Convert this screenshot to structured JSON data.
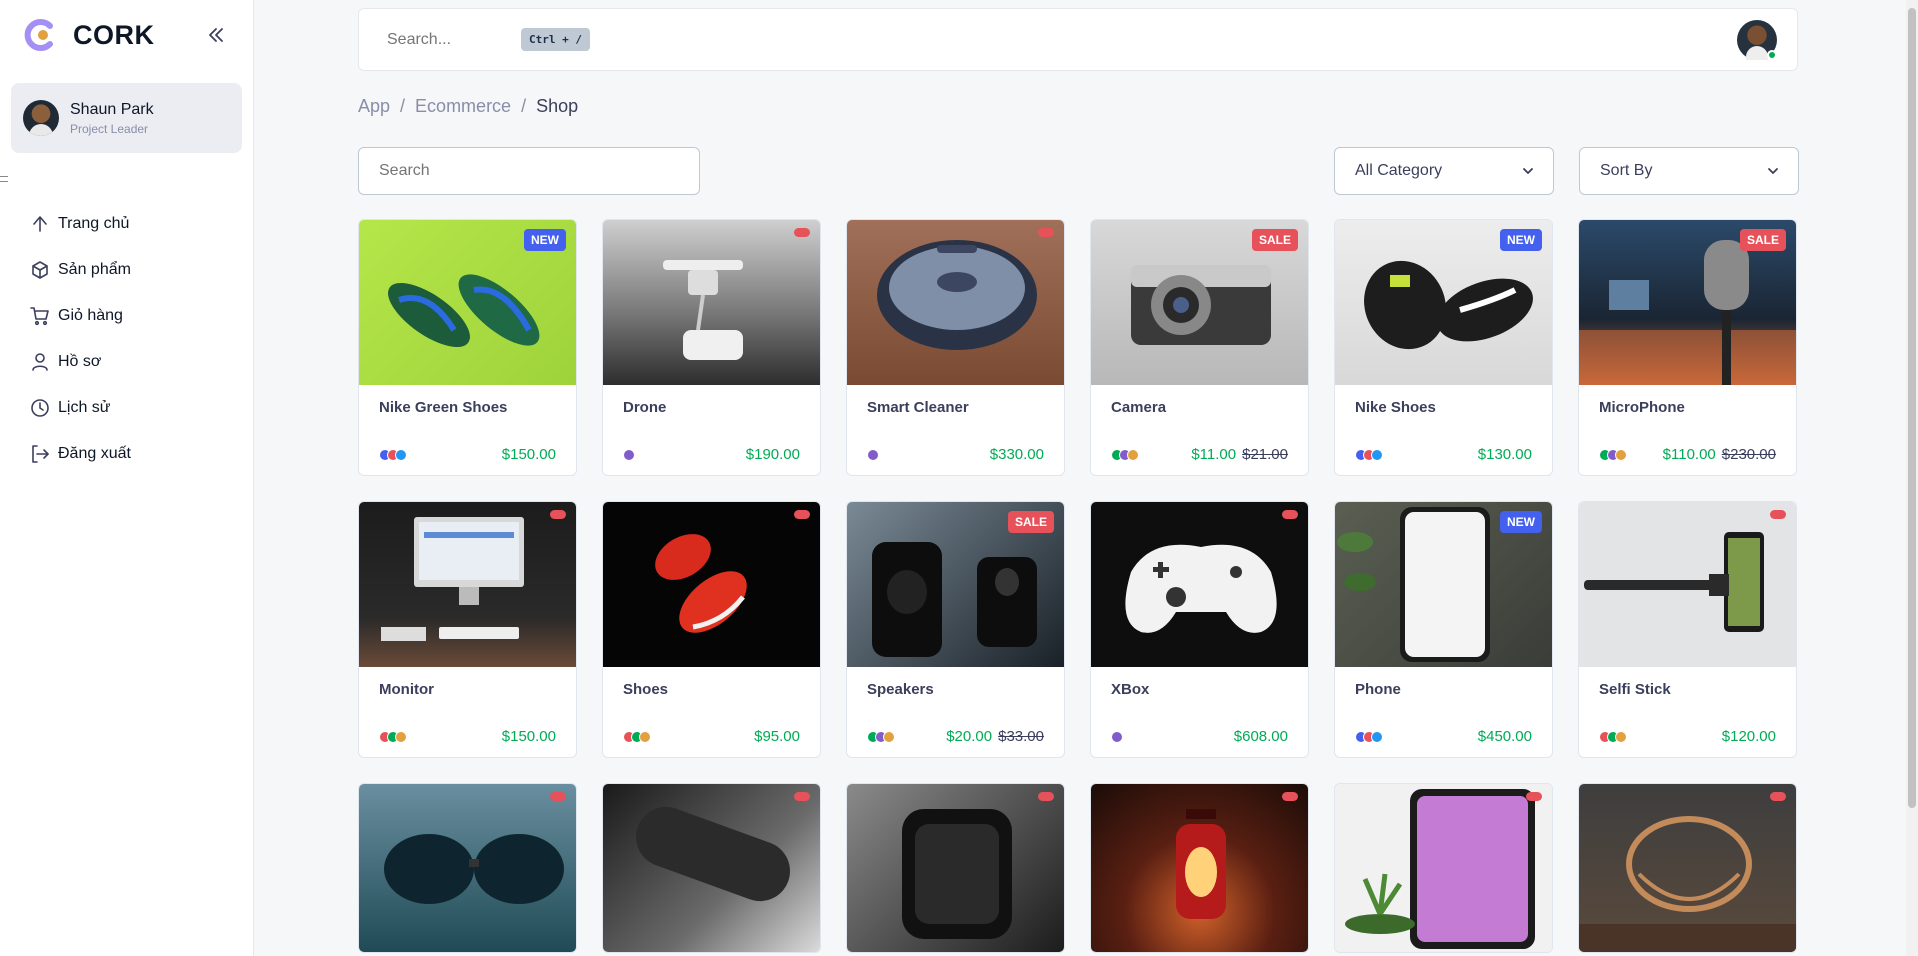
{
  "brand": {
    "name": "CORK"
  },
  "profile": {
    "name": "Shaun Park",
    "role": "Project Leader"
  },
  "menu": [
    {
      "label": "Trang chủ",
      "icon": "home-icon"
    },
    {
      "label": "Sản phẩm",
      "icon": "box-icon"
    },
    {
      "label": "Giỏ hàng",
      "icon": "cart-icon"
    },
    {
      "label": "Hồ sơ",
      "icon": "user-icon"
    },
    {
      "label": "Lịch sử",
      "icon": "clock-icon"
    },
    {
      "label": "Đăng xuất",
      "icon": "logout-icon"
    }
  ],
  "header": {
    "search_placeholder": "Search...",
    "shortcut": "Ctrl + /"
  },
  "breadcrumb": [
    "App",
    "Ecommerce",
    "Shop"
  ],
  "filters": {
    "search_placeholder": "Search",
    "category": "All Category",
    "sort": "Sort By"
  },
  "colors": {
    "accent": "#4361ee",
    "success": "#00ab55",
    "danger": "#e7515a",
    "purple": "#805dca",
    "warning": "#e2a03f",
    "info": "#2196f3"
  },
  "products": [
    {
      "name": "Nike Green Shoes",
      "price": "$150.00",
      "old_price": "",
      "badge": "NEW",
      "colors": [
        "#4361ee",
        "#e7515a",
        "#2196f3"
      ]
    },
    {
      "name": "Drone",
      "price": "$190.00",
      "old_price": "",
      "badge": "",
      "colors": [
        "#805dca"
      ]
    },
    {
      "name": "Smart Cleaner",
      "price": "$330.00",
      "old_price": "",
      "badge": "",
      "colors": [
        "#805dca"
      ]
    },
    {
      "name": "Camera",
      "price": "$11.00",
      "old_price": "$21.00",
      "badge": "SALE",
      "colors": [
        "#00ab55",
        "#805dca",
        "#e2a03f"
      ]
    },
    {
      "name": "Nike Shoes",
      "price": "$130.00",
      "old_price": "",
      "badge": "NEW",
      "colors": [
        "#4361ee",
        "#e7515a",
        "#2196f3"
      ]
    },
    {
      "name": "MicroPhone",
      "price": "$110.00",
      "old_price": "$230.00",
      "badge": "SALE",
      "colors": [
        "#00ab55",
        "#805dca",
        "#e2a03f"
      ]
    },
    {
      "name": "Monitor",
      "price": "$150.00",
      "old_price": "",
      "badge": "",
      "colors": [
        "#e7515a",
        "#00ab55",
        "#e2a03f"
      ]
    },
    {
      "name": "Shoes",
      "price": "$95.00",
      "old_price": "",
      "badge": "",
      "colors": [
        "#e7515a",
        "#00ab55",
        "#e2a03f"
      ]
    },
    {
      "name": "Speakers",
      "price": "$20.00",
      "old_price": "$33.00",
      "badge": "SALE",
      "colors": [
        "#00ab55",
        "#805dca",
        "#e2a03f"
      ]
    },
    {
      "name": "XBox",
      "price": "$608.00",
      "old_price": "",
      "badge": "",
      "colors": [
        "#805dca"
      ]
    },
    {
      "name": "Phone",
      "price": "$450.00",
      "old_price": "",
      "badge": "NEW",
      "colors": [
        "#4361ee",
        "#e7515a",
        "#2196f3"
      ]
    },
    {
      "name": "Selfi Stick",
      "price": "$120.00",
      "old_price": "",
      "badge": "",
      "colors": [
        "#e7515a",
        "#00ab55",
        "#e2a03f"
      ]
    }
  ]
}
